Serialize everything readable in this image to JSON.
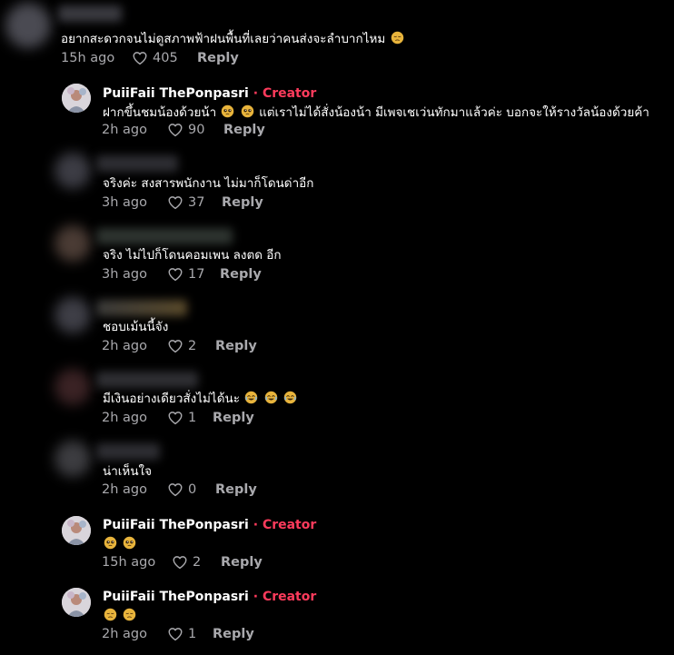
{
  "colors": {
    "background": "#000000",
    "text": "#ffffff",
    "muted": "#a9a9ad",
    "creator": "#ff3b5c",
    "emoji": "#e8b43c"
  },
  "comments": [
    {
      "text": "อยากสะดวกจนไม่ดูสภาพฟ้าฝนพื้นที่เลยว่าคนส่งจะลำบากไหม",
      "emoji_icons": [
        "pensive-face-icon"
      ],
      "time": "15h ago",
      "likes": "405",
      "reply_label": "Reply"
    },
    {
      "author": "PuiiFaii ThePonpasri",
      "separator": "·",
      "badge": "Creator",
      "text_a": "ฝากขึ้นชมน้องด้วยน้า",
      "text_b": "แต่เราไม่ได้สั่งน้องน้า มีเพจเชเว่นทักมาแล้วค่ะ บอกจะให้รางวัลน้องด้วยค้า",
      "emoji_icons": [
        "pleading-face-icon",
        "pleading-face-icon"
      ],
      "time": "2h ago",
      "likes": "90",
      "reply_label": "Reply"
    },
    {
      "text": "จริงค่ะ สงสารพนักงาน ไม่มาก็โดนด่าอีก",
      "time": "3h ago",
      "likes": "37",
      "reply_label": "Reply"
    },
    {
      "text": "จริง ไม่ไปก็โดนคอมเพน ลงตด อีก",
      "time": "3h ago",
      "likes": "17",
      "reply_label": "Reply"
    },
    {
      "text": "ชอบเม้นนี้จัง",
      "time": "2h ago",
      "likes": "2",
      "reply_label": "Reply"
    },
    {
      "text": "มีเงินอย่างเดียวสั่งไม่ได้นะ",
      "emoji_icons": [
        "tears-of-joy-icon",
        "tears-of-joy-icon",
        "tears-of-joy-icon"
      ],
      "time": "2h ago",
      "likes": "1",
      "reply_label": "Reply"
    },
    {
      "text": "น่าเห็นใจ",
      "time": "2h ago",
      "likes": "0",
      "reply_label": "Reply"
    },
    {
      "author": "PuiiFaii ThePonpasri",
      "separator": "·",
      "badge": "Creator",
      "emoji_icons": [
        "pleading-face-icon",
        "pleading-face-icon"
      ],
      "time": "15h ago",
      "likes": "2",
      "reply_label": "Reply"
    },
    {
      "author": "PuiiFaii ThePonpasri",
      "separator": "·",
      "badge": "Creator",
      "emoji_icons": [
        "pensive-face-icon",
        "pensive-face-icon"
      ],
      "time": "2h ago",
      "likes": "1",
      "reply_label": "Reply"
    }
  ]
}
